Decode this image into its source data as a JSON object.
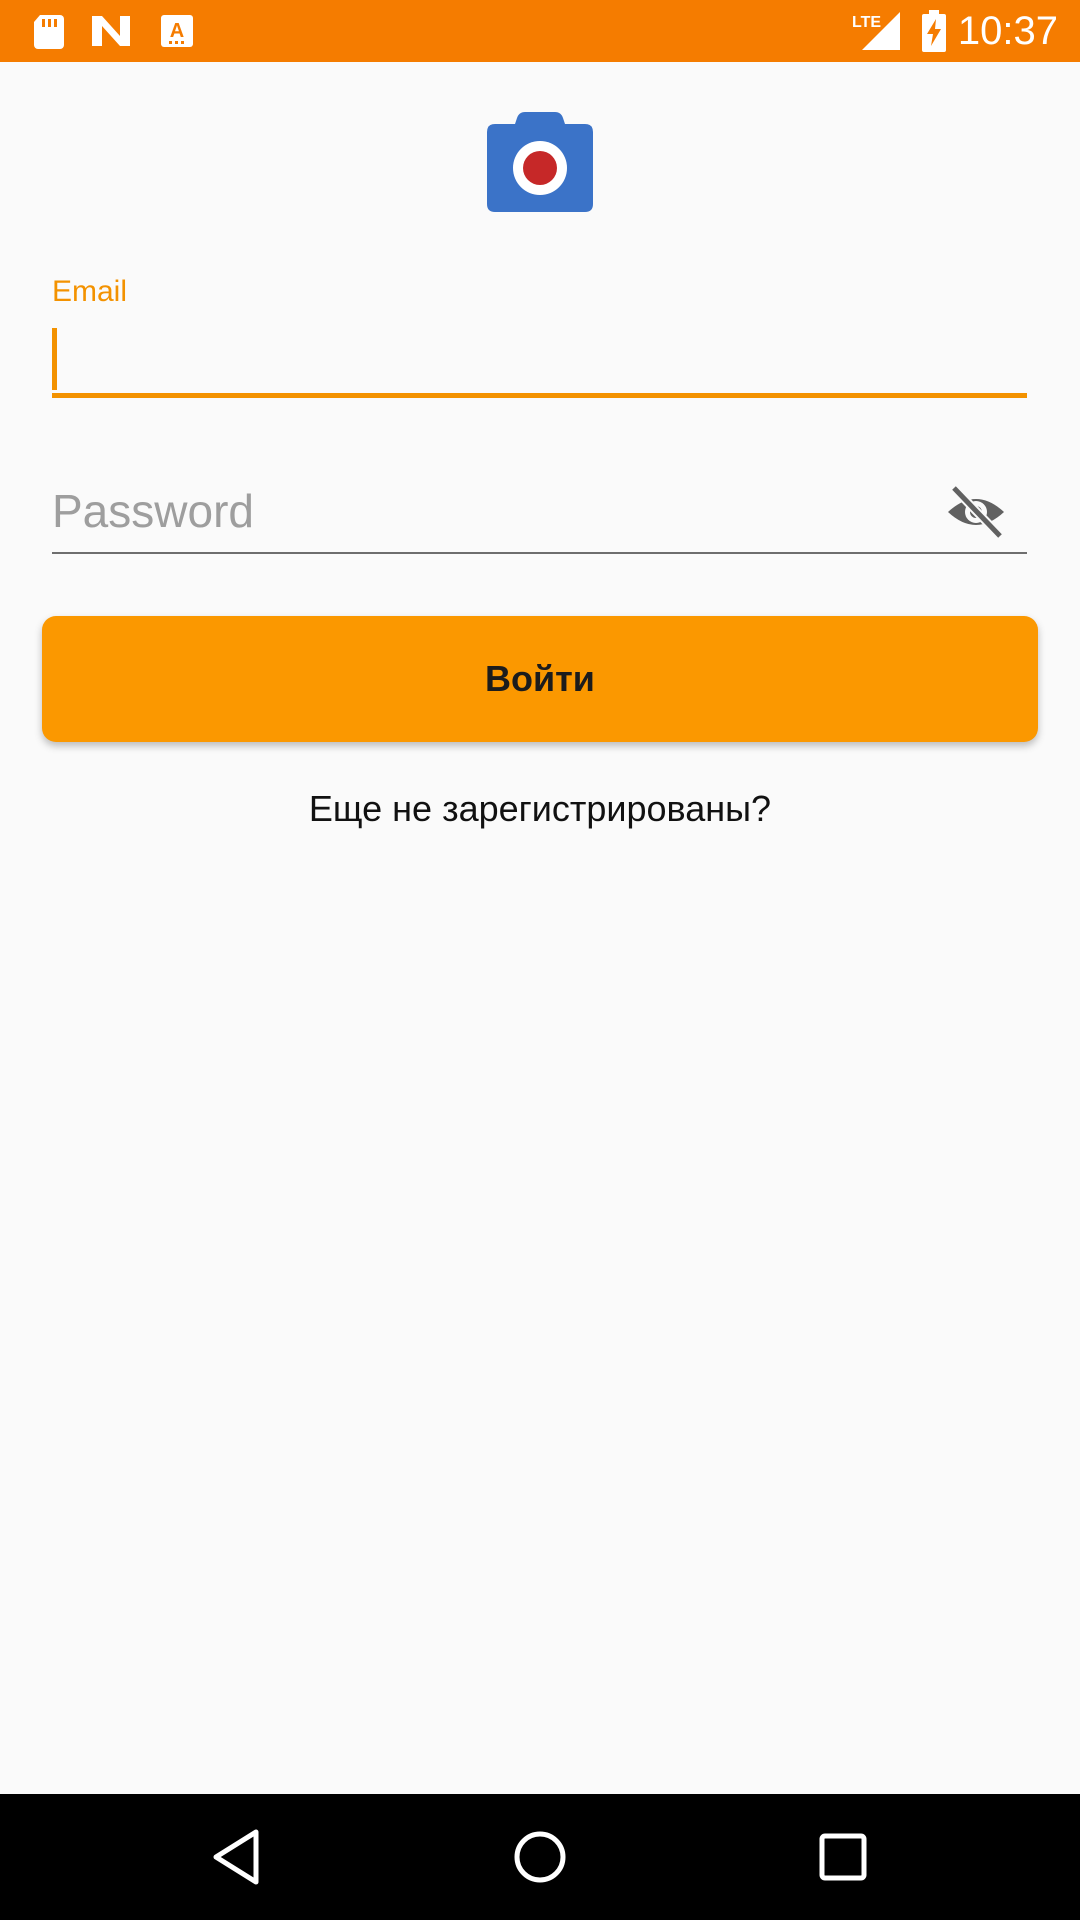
{
  "status_bar": {
    "time": "10:37",
    "network": "LTE",
    "icons": [
      "sd-card-icon",
      "n-logo-icon",
      "keyboard-a-icon",
      "lte-signal-icon",
      "battery-charging-icon"
    ],
    "background": "#f57c00"
  },
  "app": {
    "logo_icon": "camera-icon"
  },
  "login_form": {
    "email_label": "Email",
    "email_value": "",
    "password_placeholder": "Password",
    "password_value": "",
    "visibility_icon": "eye-off-icon",
    "submit_label": "Войти",
    "register_link": "Еще не зарегистрированы?"
  },
  "nav_bar": {
    "icons": [
      "back-icon",
      "home-icon",
      "recents-icon"
    ]
  },
  "colors": {
    "accent": "#f39200",
    "button": "#fb9800",
    "logo_blue": "#3b73c8",
    "logo_red": "#c62828"
  }
}
